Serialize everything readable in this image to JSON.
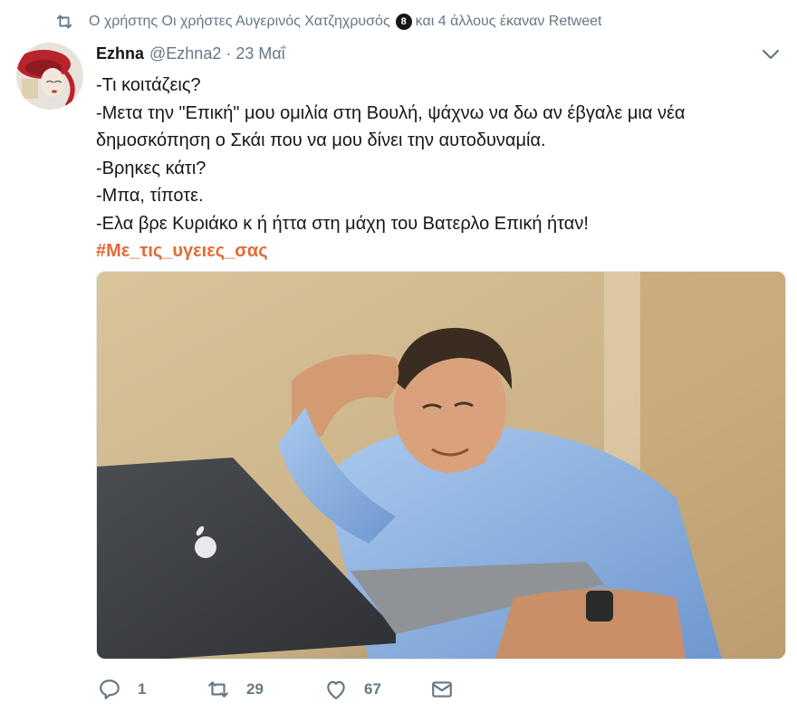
{
  "context": {
    "text_before": "Ο χρήστης Οι χρήστες Αυγερινός Χατζηχρυσός",
    "badge": "8",
    "text_after": "και 4 άλλους έκαναν Retweet"
  },
  "tweet": {
    "author_name": "Ezhna",
    "author_handle": "@Ezhna2",
    "separator": "·",
    "date": "23 Μαΐ",
    "lines": [
      "-Τι κοιτάζεις?",
      "-Μετα την \"Επική\" μου ομιλία στη Βουλή, ψάχνω να δω αν έβγαλε μια νέα δημοσκόπηση ο Σκάι που να μου δίνει την αυτοδυναμία.",
      "-Βρηκες κάτι?",
      "-Μπα, τίποτε.",
      "-Ελα βρε Κυριάκο κ ή ήττα στη μάχη του Βατερλο Επική ήταν!"
    ],
    "hashtag": "#Με_τις_υγειες_σας"
  },
  "actions": {
    "reply_count": "1",
    "retweet_count": "29",
    "like_count": "67"
  },
  "icons": {
    "context": "retweet-icon",
    "menu": "chevron-down-icon",
    "reply": "reply-icon",
    "retweet": "retweet-icon",
    "like": "heart-icon",
    "dm": "envelope-icon"
  },
  "colors": {
    "hashtag": "#e26a34",
    "secondary_text": "#657786",
    "primary_text": "#14171a"
  }
}
